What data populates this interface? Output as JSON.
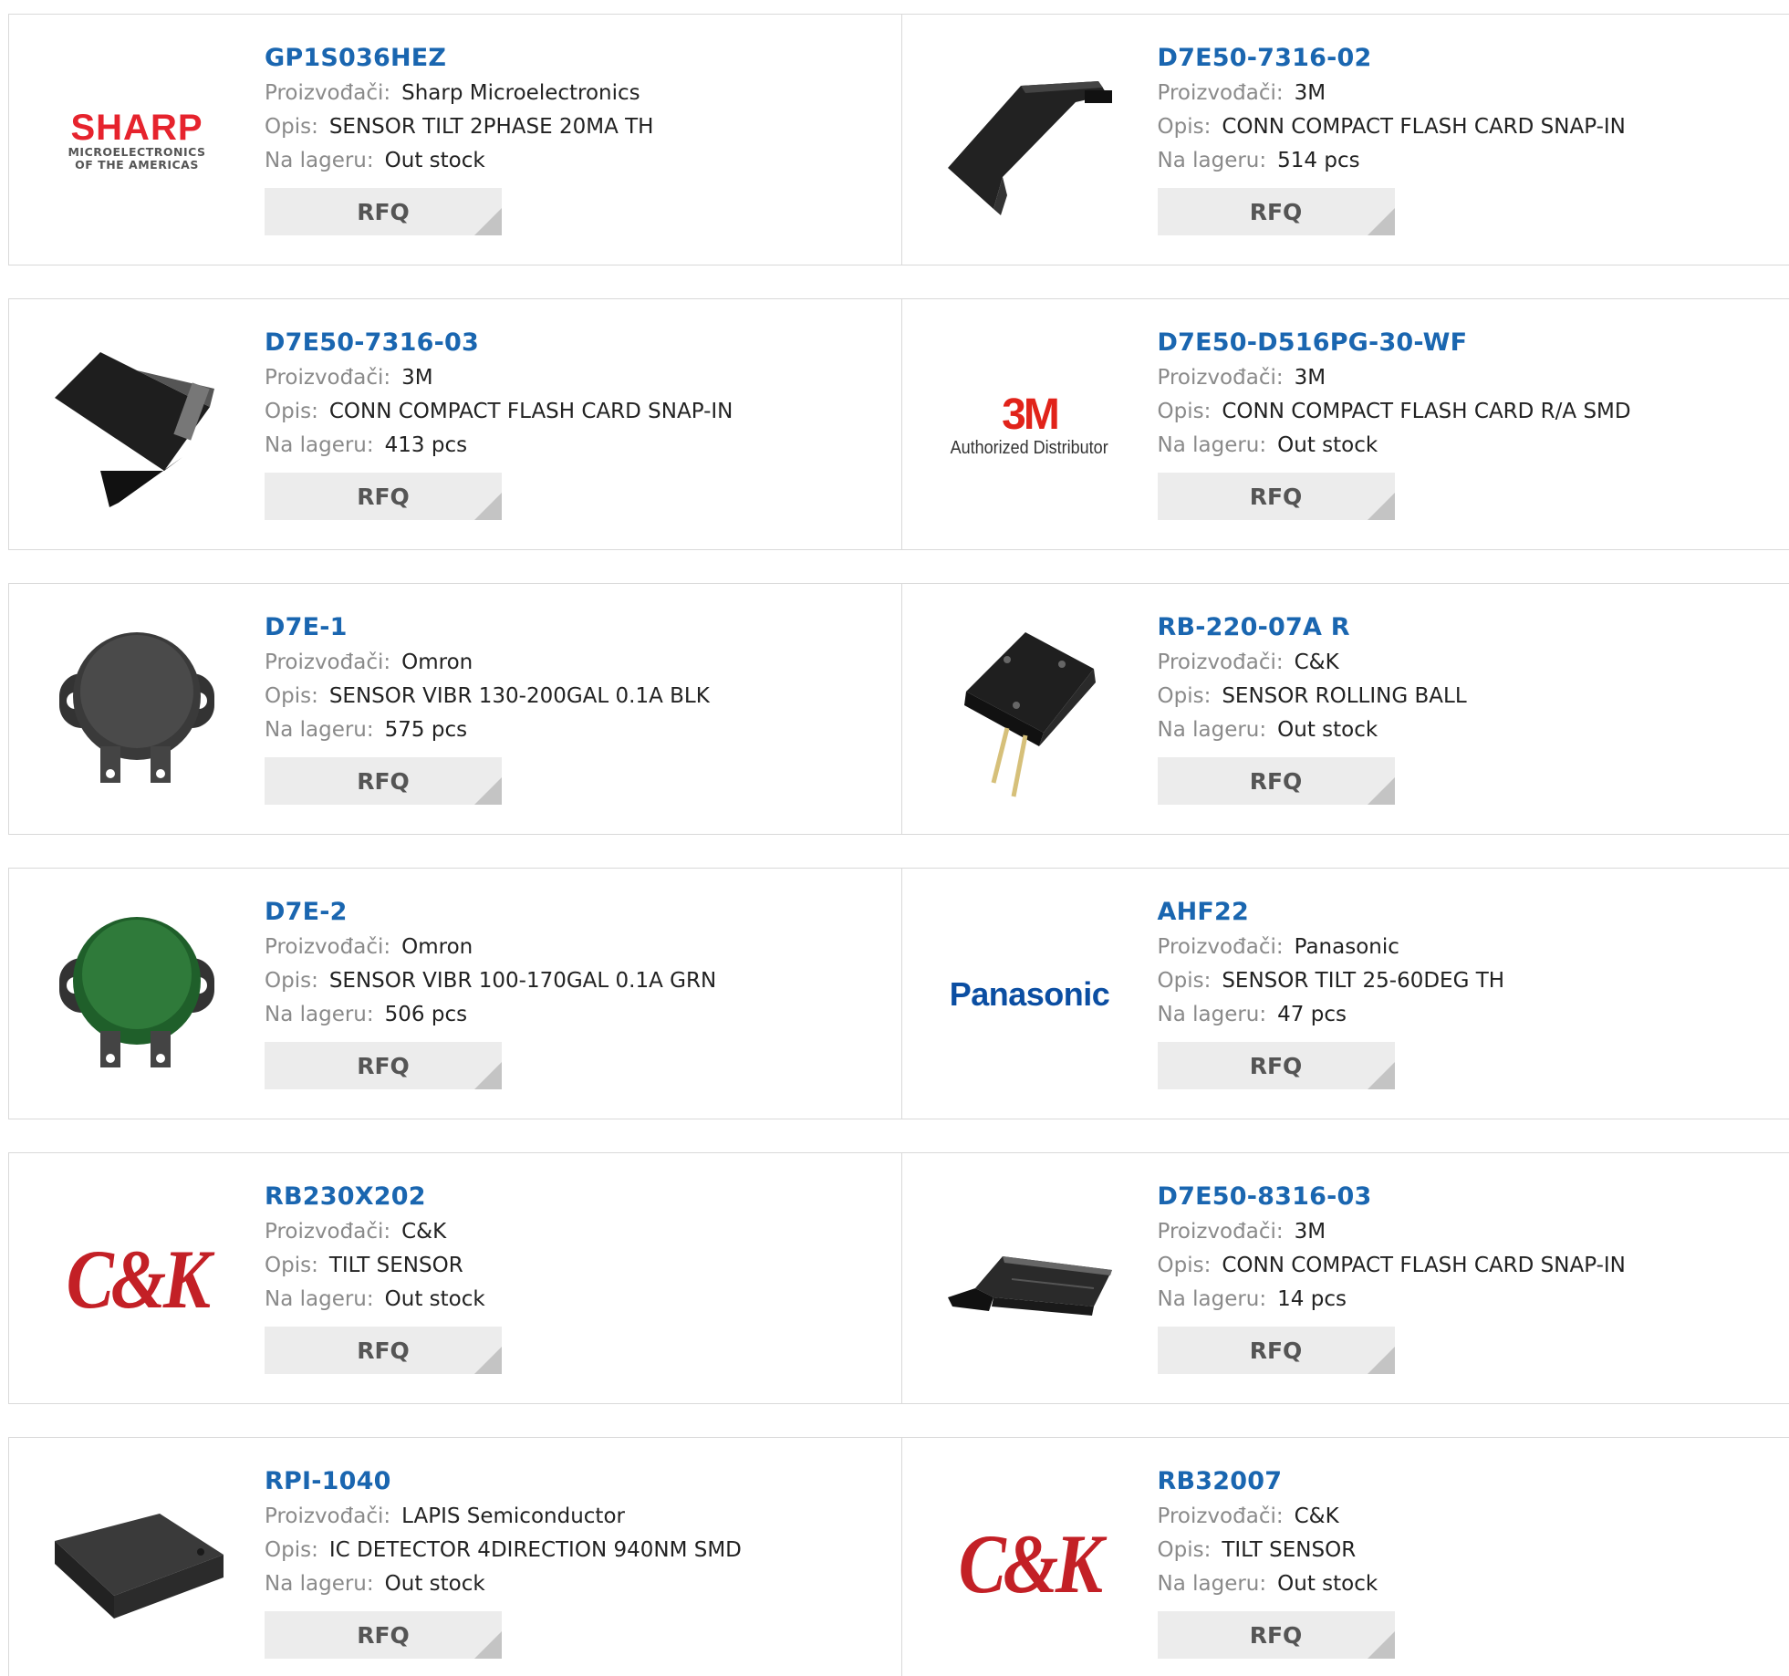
{
  "labels": {
    "manufacturer": "Proizvođači:",
    "description": "Opis:",
    "stock": "Na lageru:",
    "rfq": "RFQ"
  },
  "logos": {
    "sharp": {
      "brand": "SHARP",
      "line1": "MICROELECTRONICS",
      "line2": "OF THE AMERICAS"
    },
    "threem": {
      "brand": "3M",
      "tagline": "Authorized Distributor"
    },
    "panasonic": {
      "brand": "Panasonic"
    },
    "ck": {
      "brand": "C&K"
    }
  },
  "products": [
    {
      "part": "GP1S036HEZ",
      "manufacturer": "Sharp Microelectronics",
      "description": "SENSOR TILT 2PHASE 20MA TH",
      "stock": "Out stock",
      "image": "sharp-logo"
    },
    {
      "part": "D7E50-7316-02",
      "manufacturer": "3M",
      "description": "CONN COMPACT FLASH CARD SNAP-IN",
      "stock": "514 pcs",
      "image": "cf-card-connector-photo"
    },
    {
      "part": "D7E50-7316-03",
      "manufacturer": "3M",
      "description": "CONN COMPACT FLASH CARD SNAP-IN",
      "stock": "413 pcs",
      "image": "cf-card-connector-photo"
    },
    {
      "part": "D7E50-D516PG-30-WF",
      "manufacturer": "3M",
      "description": "CONN COMPACT FLASH CARD R/A SMD",
      "stock": "Out stock",
      "image": "3m-logo"
    },
    {
      "part": "D7E-1",
      "manufacturer": "Omron",
      "description": "SENSOR VIBR 130-200GAL 0.1A BLK",
      "stock": "575 pcs",
      "image": "vibration-sensor-black-photo"
    },
    {
      "part": "RB-220-07A R",
      "manufacturer": "C&K",
      "description": "SENSOR ROLLING BALL",
      "stock": "Out stock",
      "image": "rolling-ball-sensor-photo"
    },
    {
      "part": "D7E-2",
      "manufacturer": "Omron",
      "description": "SENSOR VIBR 100-170GAL 0.1A GRN",
      "stock": "506 pcs",
      "image": "vibration-sensor-green-photo"
    },
    {
      "part": "AHF22",
      "manufacturer": "Panasonic",
      "description": "SENSOR TILT 25-60DEG TH",
      "stock": "47 pcs",
      "image": "panasonic-logo"
    },
    {
      "part": "RB230X202",
      "manufacturer": "C&K",
      "description": "TILT SENSOR",
      "stock": "Out stock",
      "image": "ck-logo"
    },
    {
      "part": "D7E50-8316-03",
      "manufacturer": "3M",
      "description": "CONN COMPACT FLASH CARD SNAP-IN",
      "stock": "14 pcs",
      "image": "cf-card-frame-photo"
    },
    {
      "part": "RPI-1040",
      "manufacturer": "LAPIS Semiconductor",
      "description": "IC DETECTOR 4DIRECTION 940NM SMD",
      "stock": "Out stock",
      "image": "ic-package-photo"
    },
    {
      "part": "RB32007",
      "manufacturer": "C&K",
      "description": "TILT SENSOR",
      "stock": "Out stock",
      "image": "ck-logo"
    }
  ]
}
